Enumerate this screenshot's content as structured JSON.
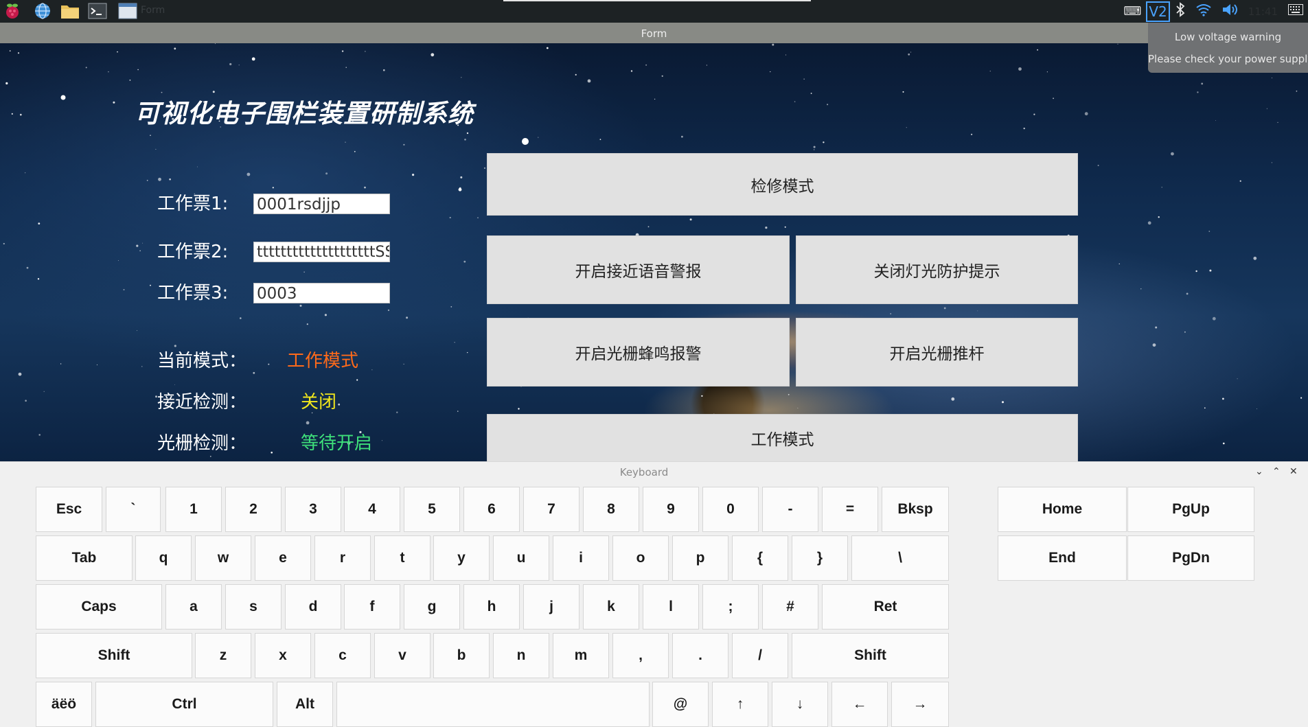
{
  "taskbar": {
    "window_label": "Form",
    "clock": "11:41",
    "icons": [
      "raspberry-menu-icon",
      "web-browser-icon",
      "file-manager-icon",
      "terminal-icon",
      "window-icon"
    ],
    "tray": {
      "vnc": "V2"
    }
  },
  "window": {
    "title": "Form"
  },
  "notification": {
    "line1": "Low voltage warning",
    "line2": "Please check your power supply"
  },
  "app": {
    "title": "可视化电子围栏装置研制系统",
    "tickets": [
      {
        "label": "工作票1:",
        "value": "0001rsdjjp"
      },
      {
        "label": "工作票2:",
        "value": "ttttttttttttttttttttSS"
      },
      {
        "label": "工作票3:",
        "value": "0003"
      }
    ],
    "status": [
      {
        "label": "当前模式：",
        "value": "工作模式",
        "color": "#ff6a1a"
      },
      {
        "label": "接近检测：",
        "value": "关闭",
        "color": "#f2e71c"
      },
      {
        "label": "光栅检测：",
        "value": "等待开启",
        "color": "#3ee07a"
      }
    ],
    "buttons": {
      "maintenance": "检修模式",
      "voice_alarm": "开启接近语音警报",
      "light_off": "关闭灯光防护提示",
      "buzzer_alarm": "开启光栅蜂鸣报警",
      "push_rod": "开启光栅推杆",
      "work_mode": "工作模式"
    }
  },
  "keyboard": {
    "title": "Keyboard",
    "controls": {
      "minimize": "⌄",
      "maximize": "⌃",
      "close": "✕"
    },
    "row1": [
      "Esc",
      "`",
      "1",
      "2",
      "3",
      "4",
      "5",
      "6",
      "7",
      "8",
      "9",
      "0",
      "-",
      "=",
      "Bksp"
    ],
    "row2": [
      "Tab",
      "q",
      "w",
      "e",
      "r",
      "t",
      "y",
      "u",
      "i",
      "o",
      "p",
      "{",
      "}",
      "\\"
    ],
    "row3": [
      "Caps",
      "a",
      "s",
      "d",
      "f",
      "g",
      "h",
      "j",
      "k",
      "l",
      ";",
      "#",
      "Ret"
    ],
    "row4": [
      "Shift",
      "z",
      "x",
      "c",
      "v",
      "b",
      "n",
      "m",
      ",",
      ".",
      "/",
      "Shift"
    ],
    "row5": [
      "äëö",
      "Ctrl",
      "Alt",
      "",
      "@",
      "↑",
      "↓",
      "←",
      "→"
    ],
    "nav": [
      "Home",
      "PgUp",
      "End",
      "PgDn"
    ]
  }
}
